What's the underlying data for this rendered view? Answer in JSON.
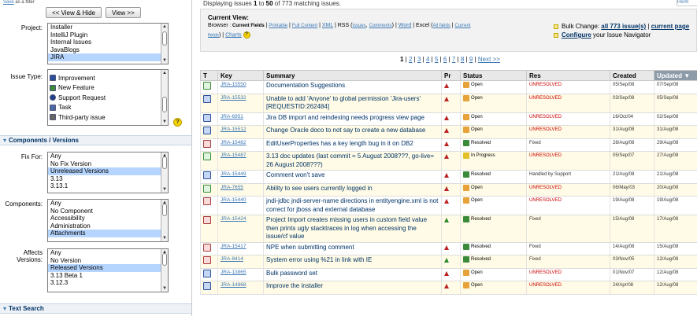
{
  "left": {
    "topline": {
      "link": "Save",
      "text": "as a filter"
    },
    "buttons": {
      "view_hide": "<< View & Hide",
      "view": "View >>"
    },
    "project": {
      "label": "Project:",
      "options": [
        "Installer",
        "IntelliJ Plugin",
        "Internal Issues",
        "JavaBlogs",
        "JIRA"
      ],
      "selected": "JIRA"
    },
    "issue_type": {
      "label": "Issue Type:",
      "options": [
        "Improvement",
        "New Feature",
        "Support Request",
        "Task",
        "Third-party issue"
      ]
    },
    "components_section": "Components / Versions",
    "fix_for": {
      "label": "Fix For:",
      "options": [
        "Any",
        "No Fix Version",
        "Unreleased Versions",
        "3.13",
        "3.13.1"
      ],
      "selected": "Unreleased Versions"
    },
    "components": {
      "label": "Components:",
      "options": [
        "Any",
        "No Component",
        "Accessibility",
        "Administration",
        "Attachments"
      ],
      "selected": "Attachments"
    },
    "affects": {
      "label_1": "Affects",
      "label_2": "Versions:",
      "options": [
        "Any",
        "No Version",
        "Released Versions",
        "3.13 Beta 1",
        "3.12.3"
      ],
      "selected": "Released Versions"
    },
    "text_search_section": "Text Search"
  },
  "right": {
    "displaying": {
      "prefix": "Displaying issues",
      "from": "1",
      "to_word": "to",
      "to": "50",
      "of_word": "of",
      "total": "773",
      "suffix": "matching issues."
    },
    "top_link": "Perm",
    "current_view": {
      "title": "Current View:",
      "browser_label": "Browser",
      "current_fields": "Current Fields",
      "printable": "Printable",
      "full_content": "Full Content",
      "xml": "XML",
      "rss_label": "RSS",
      "issues": "Issues",
      "comments": "Comments",
      "word": "Word",
      "excel_label": "Excel",
      "all_fields": "All fields",
      "current": "Current",
      "fields": "fields",
      "charts": "Charts"
    },
    "bulk": {
      "label": "Bulk Change:",
      "all_issues": "all 773 issue(s)",
      "current_page": "current page",
      "configure": "Configure",
      "navigator": "your Issue Navigator"
    },
    "pager": {
      "current": "1",
      "pages": [
        "2",
        "3",
        "4",
        "5",
        "6",
        "7",
        "8",
        "9"
      ],
      "next": "Next >>"
    },
    "columns": [
      "T",
      "Key",
      "Summary",
      "Pr",
      "Status",
      "Res",
      "Created",
      "Updated"
    ],
    "rows": [
      {
        "type": "task",
        "key": "JRA-15550",
        "summary": "Documentation Suggestions",
        "pri": "major",
        "status": "open",
        "status_text": "Open",
        "res": "UNRESOLVED",
        "created": "05/Sep/08",
        "updated": "07/Sep/08"
      },
      {
        "type": "improvement",
        "key": "JRA-15532",
        "summary": "Unable to add 'Anyone' to global permission 'Jira-users' [REQUESTID:262484]",
        "pri": "major",
        "status": "open",
        "status_text": "Open",
        "res": "UNRESOLVED",
        "created": "03/Sep/08",
        "updated": "05/Sep/08"
      },
      {
        "type": "improvement",
        "key": "JRA-6951",
        "summary": "Jira DB import and reindexing needs progress view page",
        "pri": "major",
        "status": "open",
        "status_text": "Open",
        "res": "UNRESOLVED",
        "created": "16/Oct/04",
        "updated": "02/Sep/08"
      },
      {
        "type": "improvement",
        "key": "JRA-15512",
        "summary": "Change Oracle doco to not say to create a new database",
        "pri": "major",
        "status": "open",
        "status_text": "Open",
        "res": "UNRESOLVED",
        "created": "31/Aug/08",
        "updated": "31/Aug/08"
      },
      {
        "type": "bug",
        "key": "JRA-15482",
        "summary": "EditUserProperties has a key length bug in it on DB2",
        "pri": "major",
        "status": "resolved",
        "status_text": "Resolved",
        "res": "Fixed",
        "created": "28/Aug/08",
        "updated": "29/Aug/08"
      },
      {
        "type": "task",
        "key": "JRA-15487",
        "summary": "3.13 doc updates (last commit = 5 August 2008???, go-live= 26 August 2008???)",
        "pri": "major",
        "status": "progress",
        "status_text": "In Progress",
        "res": "UNRESOLVED",
        "created": "05/Sep/07",
        "updated": "27/Aug/08"
      },
      {
        "type": "improvement",
        "key": "JRA-15449",
        "summary": "Comment won't save",
        "pri": "major",
        "status": "resolved",
        "status_text": "Resolved",
        "res": "Handled by Support",
        "created": "21/Aug/08",
        "updated": "21/Aug/08"
      },
      {
        "type": "task",
        "key": "JRA-7655",
        "summary": "Ability to see users currently logged in",
        "pri": "major",
        "status": "open",
        "status_text": "Open",
        "res": "UNRESOLVED",
        "created": "06/May/03",
        "updated": "20/Aug/08"
      },
      {
        "type": "bug",
        "key": "JRA-15440",
        "summary": "jndi-jdbc jndi-server-name directions in entityengine.xml is not correct for jboss and external database",
        "pri": "major",
        "status": "open",
        "status_text": "Open",
        "res": "UNRESOLVED",
        "created": "19/Aug/08",
        "updated": "19/Aug/08"
      },
      {
        "type": "bug",
        "key": "JRA-15424",
        "summary": "Project Import creates missing users in custom field value then prints ugly stacktraces in log when accessing the issue/cf value",
        "pri": "minor",
        "status": "resolved",
        "status_text": "Resolved",
        "res": "Fixed",
        "created": "15/Aug/08",
        "updated": "17/Aug/08"
      },
      {
        "type": "bug",
        "key": "JRA-15417",
        "summary": "NPE when submitting comment",
        "pri": "major",
        "status": "resolved",
        "status_text": "Resolved",
        "res": "Fixed",
        "created": "14/Aug/08",
        "updated": "15/Aug/08"
      },
      {
        "type": "bug",
        "key": "JRA-8414",
        "summary": "System error using %21 in link with IE",
        "pri": "minor",
        "status": "resolved",
        "status_text": "Resolved",
        "res": "Fixed",
        "created": "03/Nov/05",
        "updated": "12/Aug/08"
      },
      {
        "type": "improvement",
        "key": "JRA-13865",
        "summary": "Bulk password set",
        "pri": "major",
        "status": "open",
        "status_text": "Open",
        "res": "UNRESOLVED",
        "created": "01/Nov/07",
        "updated": "12/Aug/08"
      },
      {
        "type": "improvement",
        "key": "JRA-14868",
        "summary": "Improve the installer",
        "pri": "major",
        "status": "open",
        "status_text": "Open",
        "res": "UNRESOLVED",
        "created": "24/Apr/08",
        "updated": "12/Aug/08"
      }
    ]
  },
  "colors": {
    "link": "#3c78b5",
    "unresolved": "#cc0000",
    "header_bg": "#e8e8e8",
    "sorted_header": "#8d9aa8",
    "row_alt": "#fffbe6"
  }
}
